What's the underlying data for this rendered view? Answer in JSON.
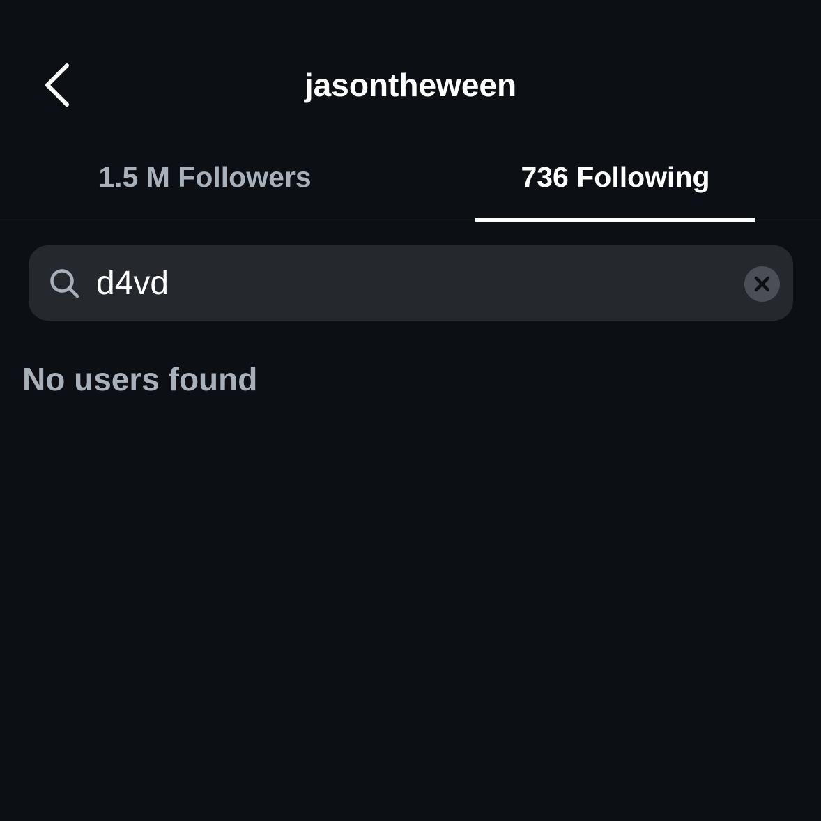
{
  "header": {
    "title": "jasontheween"
  },
  "tabs": [
    {
      "label": "1.5 M Followers",
      "active": false
    },
    {
      "label": "736 Following",
      "active": true
    }
  ],
  "search": {
    "value": "d4vd"
  },
  "results": {
    "empty_message": "No users found"
  },
  "icons": {
    "back": "chevron-left-icon",
    "search": "search-icon",
    "clear": "close-icon"
  },
  "colors": {
    "background": "#0c1014",
    "search_bg": "#25292e",
    "muted_text": "#a8b0ba",
    "active_text": "#ffffff"
  }
}
